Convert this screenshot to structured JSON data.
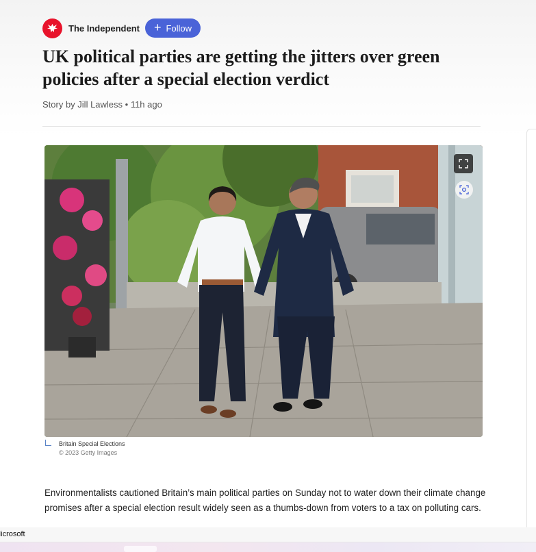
{
  "publisher": {
    "name": "The Independent",
    "follow_label": "Follow",
    "logo_icon": "independent-eagle-icon",
    "brand_color": "#e8132b",
    "follow_color": "#4a63d8"
  },
  "article": {
    "headline": "UK political parties are getting the jitters over green policies after a special election verdict",
    "byline": "Story by Jill Lawless • 11h ago",
    "image": {
      "caption": "Britain Special Elections",
      "credit": "© 2023 Getty Images",
      "expand_icon": "expand-icon",
      "visual_search_icon": "visual-search-icon"
    },
    "body": "Environmentalists cautioned Britain’s main political parties on Sunday not to water down their climate change promises after a special election result widely seen as a thumbs-down from voters to a tax on polluting cars."
  },
  "taskbar": {
    "label": "Microsoft"
  }
}
